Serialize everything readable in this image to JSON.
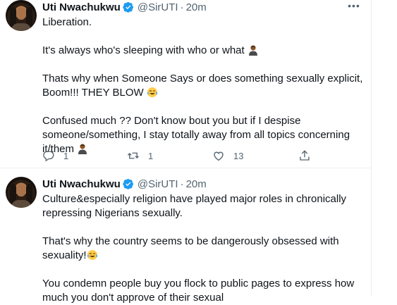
{
  "tweets": [
    {
      "name": "Uti Nwachukwu",
      "handle": "@SirUTI",
      "separator": "·",
      "time": "20m",
      "paragraphs": [
        "Liberation.",
        "It's always who's sleeping with who or what",
        "Thats why when  Someone Says or does something sexually explicit, Boom!!! THEY BLOW",
        "Confused much ?? Don't know bout you but if I despise someone/something, I stay totally away from all topics concerning it/them"
      ],
      "stats": {
        "replies": "1",
        "retweets": "1",
        "likes": "13"
      }
    },
    {
      "name": "Uti Nwachukwu",
      "handle": "@SirUTI",
      "separator": "·",
      "time": "20m",
      "paragraphs": [
        "Culture&especially religion have played major roles in chronically repressing Nigerians sexually.",
        "That's why the country seems to be dangerously obsessed with sexuality!",
        "You condemn people buy you flock to public pages to express how much you don't approve of their sexual"
      ]
    }
  ],
  "icons": {
    "verified": "verified-badge-icon",
    "more": "more-options-icon",
    "reply": "reply-icon",
    "retweet": "retweet-icon",
    "like": "like-heart-icon",
    "share": "share-icon",
    "emoji_person": "person-shrugging-emoji",
    "emoji_laugh": "face-with-tears-of-joy-emoji"
  },
  "colors": {
    "verified": "#1d9bf0",
    "secondary_text": "#536471",
    "primary_text": "#0f1419",
    "divider": "#ebeef0"
  }
}
